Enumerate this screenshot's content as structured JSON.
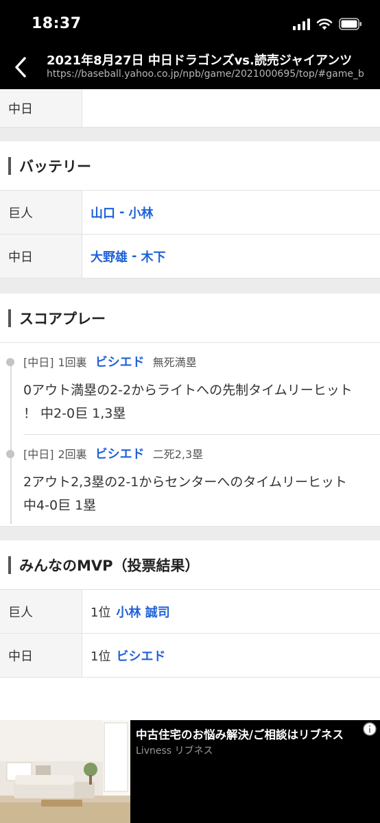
{
  "status": {
    "time": "18:37"
  },
  "browser": {
    "title": "2021年8月27日 中日ドラゴンズvs.読売ジャイアンツ",
    "url": "https://baseball.yahoo.co.jp/npb/game/2021000695/top/#game_b"
  },
  "top_row": {
    "team": "中日",
    "value": ""
  },
  "battery": {
    "heading": "バッテリー",
    "rows": [
      {
        "team": "巨人",
        "pitcher": "山口",
        "sep": "-",
        "catcher": "小林"
      },
      {
        "team": "中日",
        "pitcher": "大野雄",
        "sep": "-",
        "catcher": "木下"
      }
    ]
  },
  "score_play": {
    "heading": "スコアプレー",
    "plays": [
      {
        "team": "[中日]",
        "inning": "1回裏",
        "batter": "ビシエド",
        "situation": "無死満塁",
        "desc_line1": "0アウト満塁の2-2からライトへの先制タイムリーヒット",
        "desc_line2": "！ 中2-0巨 1,3塁"
      },
      {
        "team": "[中日]",
        "inning": "2回裏",
        "batter": "ビシエド",
        "situation": "二死2,3塁",
        "desc_line1": "2アウト2,3塁の2-1からセンターへのタイムリーヒット",
        "desc_line2": "中4-0巨 1塁"
      }
    ]
  },
  "mvp": {
    "heading": "みんなのMVP（投票結果）",
    "rows": [
      {
        "team": "巨人",
        "rank": "1位",
        "player": "小林 誠司"
      },
      {
        "team": "中日",
        "rank": "1位",
        "player": "ビシエド"
      }
    ]
  },
  "ad": {
    "headline": "中古住宅のお悩み解決/ご相談はリブネス",
    "sponsor": "Livness リブネス",
    "info_icon": "info-icon"
  },
  "colors": {
    "link": "#1f62d8",
    "header_bg": "#000000",
    "gap": "#ececec",
    "team_cell": "#f5f5f5"
  }
}
